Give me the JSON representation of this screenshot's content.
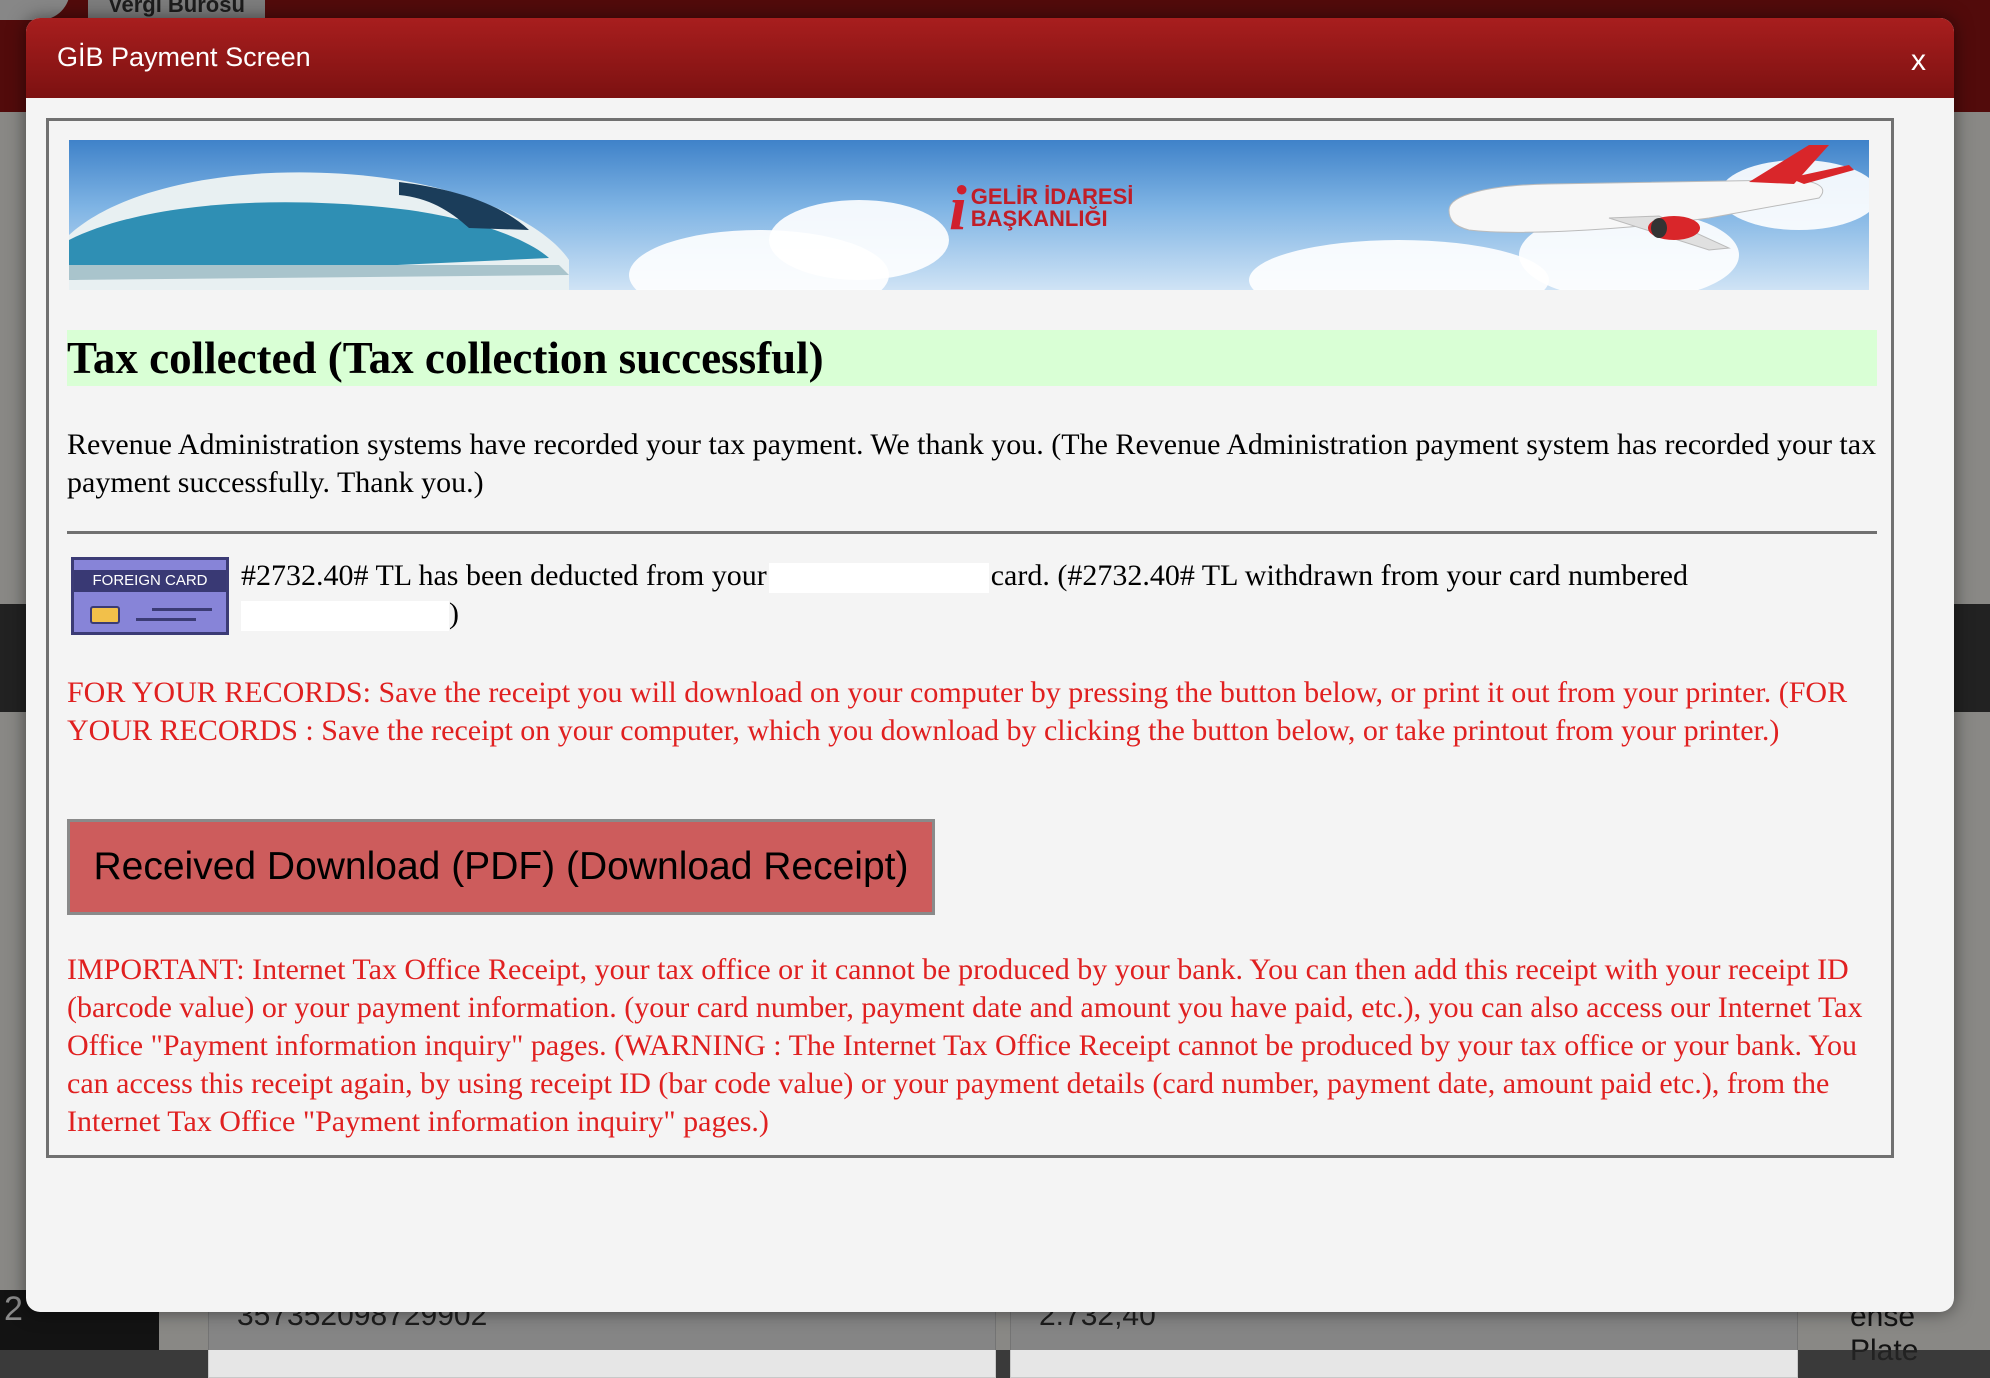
{
  "background": {
    "app_title": "Vergi Bürosu",
    "field_card_number": "357352098729902",
    "field_amount": "2.732,40",
    "right_label": "ense Plate",
    "left_label": "2"
  },
  "modal": {
    "title": "GİB Payment Screen",
    "close_label": "x",
    "banner_logo_mark": "i",
    "banner_logo_line1": "GELİR İDARESİ",
    "banner_logo_line2": "BAŞKANLIĞI",
    "success_heading": "Tax collected (Tax collection successful)",
    "message": "Revenue Administration systems have recorded your tax payment. We thank you. (The Revenue Administration payment system has recorded your tax payment successfully. Thank you.)",
    "card_label": "FOREIGN CARD",
    "deduction_part1": "#2732.40# TL has been deducted from your",
    "deduction_part2": "card. (#2732.40# TL withdrawn from your card numbered",
    "deduction_part3": ")",
    "records_note": "FOR YOUR RECORDS: Save the receipt you will download on your computer by pressing the button below, or print it out from your printer. (FOR YOUR RECORDS : Save the receipt on your computer, which you download by clicking the button below, or take printout from your printer.)",
    "download_label": "Received Download (PDF) (Download Receipt)",
    "important_note": "IMPORTANT: Internet Tax Office Receipt, your tax office or it cannot be produced by your bank. You can then add this receipt with your receipt ID (barcode value) or your payment information. (your card number, payment date and amount you have paid, etc.), you can also access our Internet Tax Office \"Payment information inquiry\" pages. (WARNING : The Internet Tax Office Receipt cannot be produced by your tax office or your bank. You can access this receipt again, by using receipt ID (bar code value) or your payment details (card number, payment date, amount paid etc.), from the Internet Tax Office \"Payment information inquiry\" pages.)"
  },
  "colors": {
    "header_red": "#8e1414",
    "success_bg": "#d9ffd5",
    "note_red": "#e02020",
    "button_bg": "#cd5c5c"
  }
}
